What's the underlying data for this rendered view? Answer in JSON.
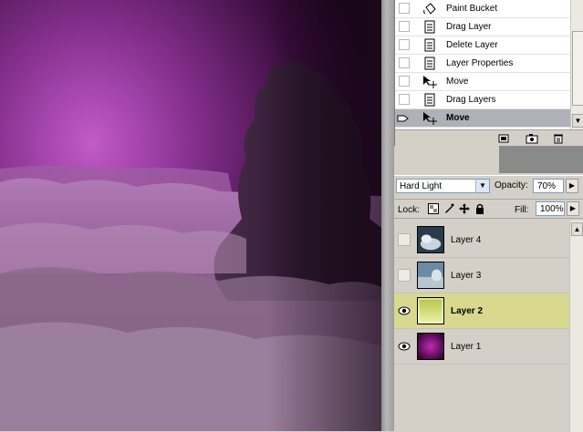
{
  "history": {
    "items": [
      {
        "label": "Paint Bucket",
        "icon": "paint-bucket-icon",
        "active": false
      },
      {
        "label": "Drag Layer",
        "icon": "history-state-icon",
        "active": false
      },
      {
        "label": "Delete Layer",
        "icon": "history-state-icon",
        "active": false
      },
      {
        "label": "Layer Properties",
        "icon": "history-state-icon",
        "active": false
      },
      {
        "label": "Move",
        "icon": "move-tool-icon",
        "active": false
      },
      {
        "label": "Drag Layers",
        "icon": "history-state-icon",
        "active": false
      },
      {
        "label": "Move",
        "icon": "move-tool-icon",
        "active": true
      }
    ]
  },
  "layers_panel": {
    "blend_mode": "Hard Light",
    "opacity_label": "Opacity:",
    "opacity_value": "70%",
    "lock_label": "Lock:",
    "fill_label": "Fill:",
    "fill_value": "100%",
    "layers": [
      {
        "name": "Layer 4",
        "visible": false,
        "active": false,
        "thumb": "clouds"
      },
      {
        "name": "Layer 3",
        "visible": false,
        "active": false,
        "thumb": "sky"
      },
      {
        "name": "Layer 2",
        "visible": true,
        "active": true,
        "thumb": "yellow-gradient"
      },
      {
        "name": "Layer 1",
        "visible": true,
        "active": false,
        "thumb": "magenta-gradient"
      }
    ]
  },
  "colors": {
    "active_layer_bg": "#d8d98f",
    "active_history_bg": "#b0b0b8",
    "canvas_magenta": "#c050c0"
  }
}
